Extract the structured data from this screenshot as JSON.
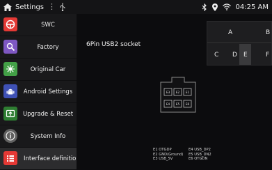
{
  "status_bar": {
    "title": "Settings",
    "menu_glyph": "⋮",
    "time": "04:25 AM",
    "icons": [
      "home-icon",
      "usb-icon",
      "bluetooth-icon",
      "location-icon",
      "wifi-icon"
    ]
  },
  "sidebar": {
    "items": [
      {
        "label": "SWC",
        "icon": "steering-wheel-icon",
        "color": "#e53935"
      },
      {
        "label": "Factory",
        "icon": "factory-icon",
        "color": "#7e57c2"
      },
      {
        "label": "Original Car",
        "icon": "original-car-icon",
        "color": "#43a047"
      },
      {
        "label": "Android Settings",
        "icon": "android-icon",
        "color": "#3f51b5"
      },
      {
        "label": "Upgrade & Reset",
        "icon": "upgrade-icon",
        "color": "#2e7d32"
      },
      {
        "label": "System Info",
        "icon": "info-icon",
        "color": "#616161"
      },
      {
        "label": "Interface definition",
        "icon": "list-icon",
        "color": "#e53935"
      }
    ],
    "active_index": 6
  },
  "main": {
    "section_title": "6Pin USB2 socket",
    "keys_row1": [
      "A",
      "B"
    ],
    "keys_row2": [
      "C",
      "D",
      "E",
      "F"
    ],
    "selected_key": "E",
    "pins_row1": [
      "E3",
      "E2",
      "E1"
    ],
    "pins_row2": [
      "E4",
      "E5",
      "E6"
    ],
    "legend_left": [
      "E1 OTGDP",
      "E2 GND(Ground)",
      "E3 USB_5V"
    ],
    "legend_right": [
      "E4 USB_DP2",
      "E5 USB_DN2",
      "E6 OTGDN"
    ]
  }
}
